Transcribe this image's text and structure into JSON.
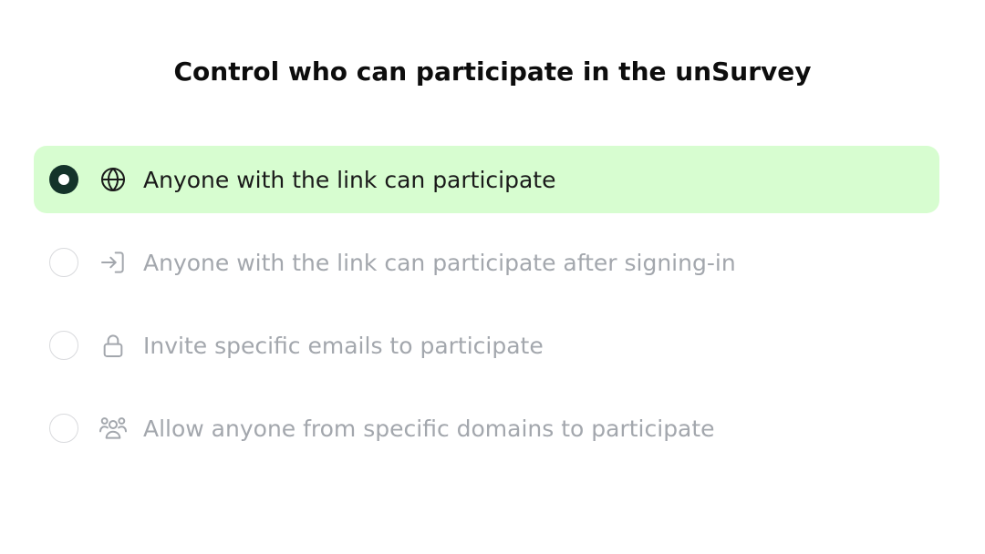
{
  "header": {
    "title": "Control who can participate in the unSurvey"
  },
  "options": [
    {
      "label": "Anyone with the link can participate",
      "icon": "globe-icon",
      "selected": true
    },
    {
      "label": "Anyone with the link can participate after signing-in",
      "icon": "sign-in-icon",
      "selected": false
    },
    {
      "label": "Invite specific emails to participate",
      "icon": "lock-icon",
      "selected": false
    },
    {
      "label": "Allow anyone from specific domains to participate",
      "icon": "users-group-icon",
      "selected": false
    }
  ],
  "colors": {
    "selected_background": "#d7fdd0",
    "radio_selected": "#14332a",
    "muted_text": "#a3a7ad",
    "text": "#1a1a1a"
  }
}
